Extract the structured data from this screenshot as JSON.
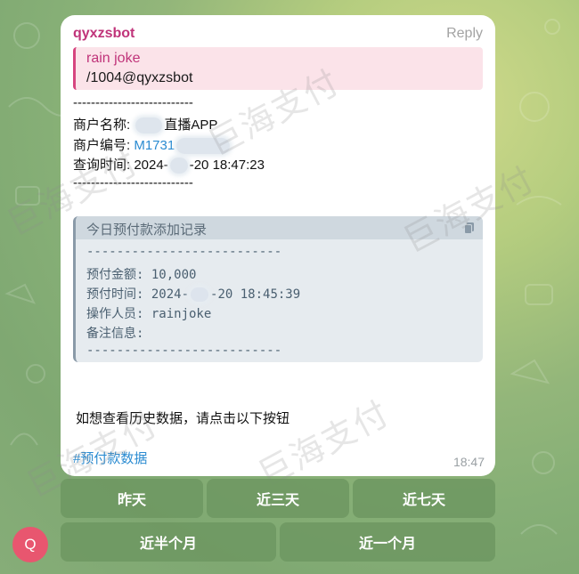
{
  "message": {
    "sender": "qyxzsbot",
    "reply_label": "Reply",
    "quote": {
      "title": "rain joke",
      "text": "/1004@qyxzsbot"
    },
    "separator": "---------------------------",
    "merchant_name_label": "商户名称:",
    "merchant_name_value": "直播APP",
    "merchant_id_label": "商户编号:",
    "merchant_id_value": "M1731",
    "query_time_label": "查询时间:",
    "query_time_year": "2024-",
    "query_time_rest": "-20 18:47:23",
    "card": {
      "title": "今日预付款添加记录",
      "separator": "--------------------------",
      "amount_line": "预付金额: 10,000",
      "time_label": "预付时间: 2024-",
      "time_rest": "-20 18:45:39",
      "operator_line": "操作人员: rainjoke",
      "note_line": "备注信息:"
    },
    "history_prompt": "如想查看历史数据，请点击以下按钮",
    "hashtag": "#预付款数据",
    "time": "18:47"
  },
  "keyboard": {
    "yesterday": "昨天",
    "three_days": "近三天",
    "seven_days": "近七天",
    "half_month": "近半个月",
    "one_month": "近一个月"
  },
  "avatar": {
    "letter": "Q",
    "color": "#e8566f"
  },
  "watermark_text": "巨海支付"
}
